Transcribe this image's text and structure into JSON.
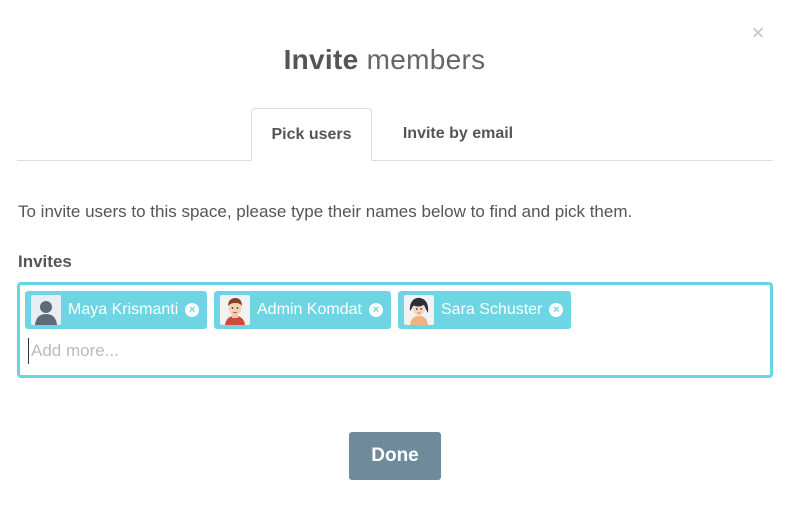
{
  "dialog": {
    "close_glyph": "×",
    "title_strong": "Invite",
    "title_light": "members"
  },
  "tabs": [
    {
      "label": "Pick users",
      "active": true
    },
    {
      "label": "Invite by email",
      "active": false
    }
  ],
  "instructions": "To invite users to this space, please type their names below to find and pick them.",
  "invites": {
    "label": "Invites",
    "chips": [
      {
        "name": "Maya Krismanti",
        "avatar": "default-user-avatar"
      },
      {
        "name": "Admin Komdat",
        "avatar": "male-user-avatar"
      },
      {
        "name": "Sara Schuster",
        "avatar": "female-user-avatar"
      }
    ],
    "remove_glyph": "×",
    "placeholder": "Add more...",
    "chip_color": "#6dd5e4",
    "border_color": "#6ad3e3"
  },
  "done_label": "Done",
  "done_color": "#6f8b9b"
}
